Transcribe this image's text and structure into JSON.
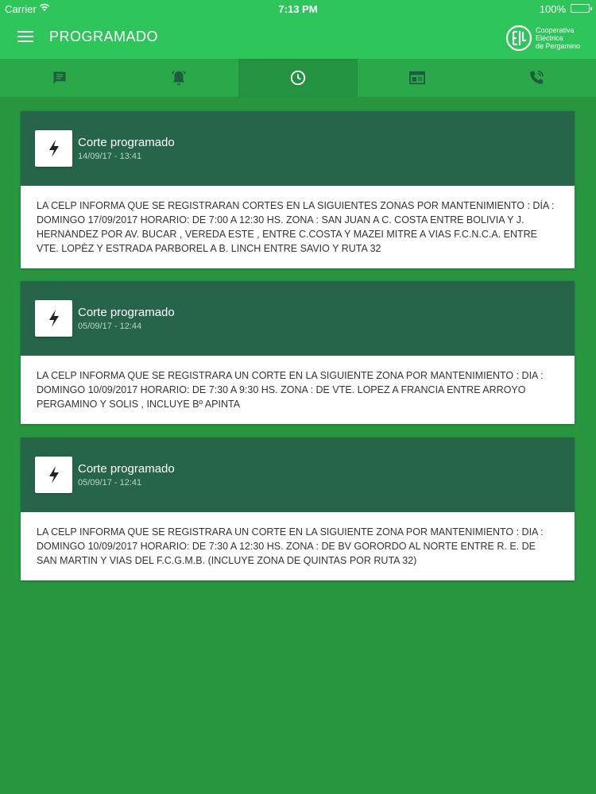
{
  "status_bar": {
    "carrier": "Carrier",
    "time": "7:13 PM",
    "battery": "100%",
    "battery_level": 1.0
  },
  "header": {
    "title": "PROGRAMADO",
    "logo_text": [
      "Cooperativa",
      "Eléctrica",
      "de Pergamino"
    ]
  },
  "tabs": [
    {
      "icon": "message-icon",
      "active": false
    },
    {
      "icon": "bell-icon",
      "active": false
    },
    {
      "icon": "clock-icon",
      "active": true
    },
    {
      "icon": "news-icon",
      "active": false
    },
    {
      "icon": "phone-icon",
      "active": false
    }
  ],
  "cards": [
    {
      "title": "Corte programado",
      "date": "14/09/17 - 13:41",
      "body": "LA CELP INFORMA QUE SE REGISTRARAN CORTES EN LA SIGUIENTES ZONAS POR MANTENIMIENTO : DÍA : DOMINGO 17/09/2017 HORARIO: DE 7:00 A 12:30 HS. ZONA : SAN JUAN A C. COSTA ENTRE BOLIVIA Y J. HERNANDEZ POR AV. BUCAR , VEREDA ESTE , ENTRE C.COSTA Y MAZEI MITRE A VIAS F.C.N.C.A. ENTRE VTE. LOPÈZ Y ESTRADA PARBOREL A B. LINCH ENTRE SAVIO Y RUTA 32"
    },
    {
      "title": "Corte programado",
      "date": "05/09/17 - 12:44",
      "body": "LA CELP INFORMA QUE SE REGISTRARA UN CORTE EN LA SIGUIENTE ZONA POR MANTENIMIENTO : DIA : DOMINGO 10/09/2017 HORARIO: DE 7:30 A 9:30 HS. ZONA : DE VTE. LOPEZ A FRANCIA ENTRE ARROYO PERGAMINO Y SOLIS , INCLUYE Bº APINTA"
    },
    {
      "title": "Corte programado",
      "date": "05/09/17 - 12:41",
      "body": "LA CELP INFORMA QUE SE REGISTRARA UN CORTE EN LA SIGUIENTE ZONA POR MANTENIMIENTO : DIA : DOMINGO 10/09/2017 HORARIO: DE 7:30 A 12:30 HS. ZONA : DE BV GORORDO AL NORTE ENTRE R. E. DE SAN MARTIN Y VIAS DEL F.C.G.M.B. (INCLUYE ZONA DE QUINTAS POR RUTA 32)"
    }
  ],
  "colors": {
    "app_bar": "#2ec55a",
    "background": "#27963f",
    "card_header": "#26654a"
  }
}
